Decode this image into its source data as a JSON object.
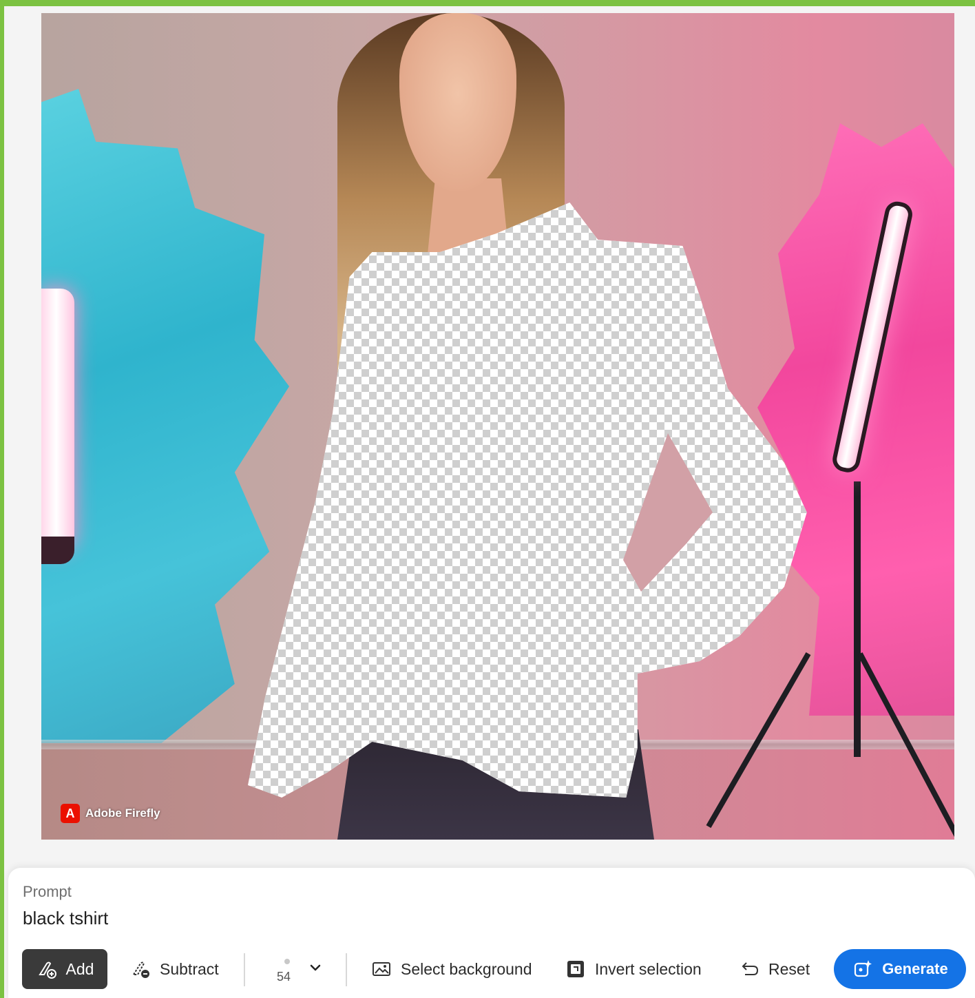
{
  "canvas": {
    "watermark_logo": "A",
    "watermark_text": "Adobe Firefly"
  },
  "prompt": {
    "label": "Prompt",
    "value": "black tshirt"
  },
  "toolbar": {
    "add_label": "Add",
    "add_icon": "brush-add-icon",
    "subtract_label": "Subtract",
    "subtract_icon": "brush-subtract-icon",
    "brush_size": "54",
    "brush_size_icon": "chevron-down-icon",
    "select_background_label": "Select background",
    "select_background_icon": "image-icon",
    "invert_selection_label": "Invert selection",
    "invert_selection_icon": "invert-icon",
    "reset_label": "Reset",
    "reset_icon": "undo-icon",
    "generate_label": "Generate",
    "generate_icon": "sparkle-icon"
  },
  "colors": {
    "accent": "#1473e6",
    "frame": "#7cc242",
    "active_tool": "#3a3a3a"
  }
}
